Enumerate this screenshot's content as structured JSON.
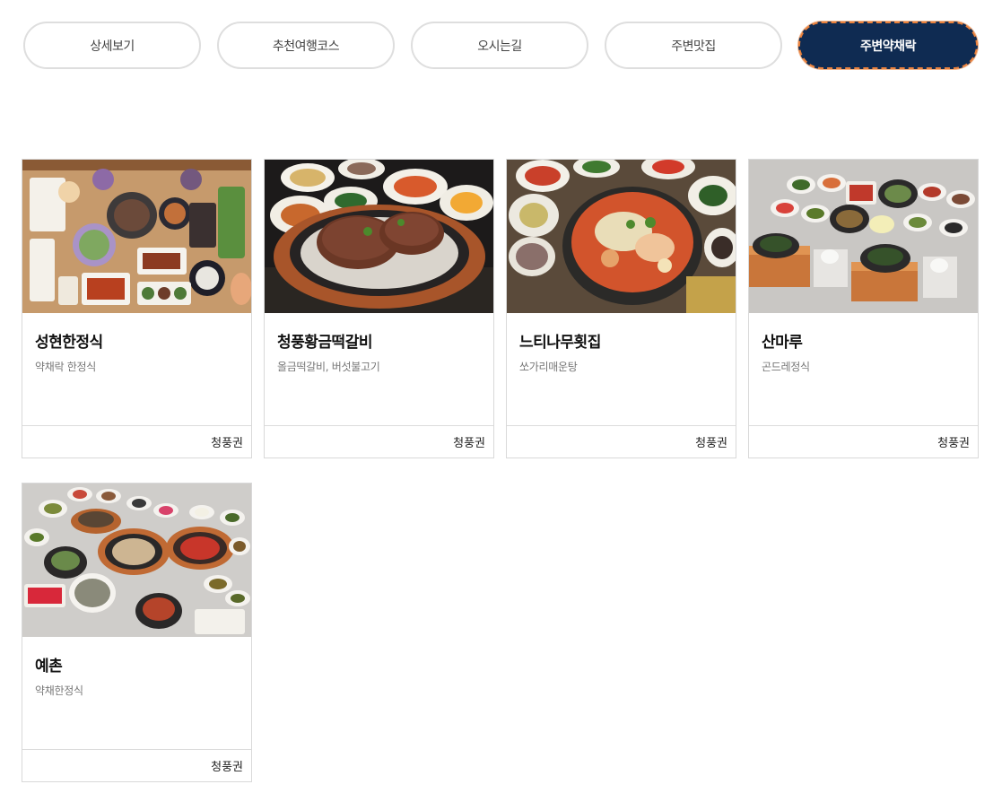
{
  "tabs": [
    {
      "label": "상세보기",
      "active": false
    },
    {
      "label": "추천여행코스",
      "active": false
    },
    {
      "label": "오시는길",
      "active": false
    },
    {
      "label": "주변맛집",
      "active": false
    },
    {
      "label": "주변약채락",
      "active": true
    }
  ],
  "restaurants": [
    {
      "name": "성현한정식",
      "menu": "약채락 한정식",
      "region": "청풍권",
      "photo": "korean-table-set-photo"
    },
    {
      "name": "청풍황금떡갈비",
      "menu": "올금떡갈비, 버섯불고기",
      "region": "청풍권",
      "photo": "tteokgalbi-sizzling-plate-photo"
    },
    {
      "name": "느티나무횟집",
      "menu": "쏘가리매운탕",
      "region": "청풍권",
      "photo": "spicy-fish-stew-photo"
    },
    {
      "name": "산마루",
      "menu": "곤드레정식",
      "region": "청풍권",
      "photo": "gondre-rice-set-photo"
    },
    {
      "name": "예촌",
      "menu": "약채한정식",
      "region": "청풍권",
      "photo": "herb-table-set-photo"
    }
  ],
  "colors": {
    "active_tab_bg": "#0f2b52",
    "active_tab_border": "#e8803c",
    "tab_border": "#dedede",
    "card_border": "#d9d9d9"
  }
}
